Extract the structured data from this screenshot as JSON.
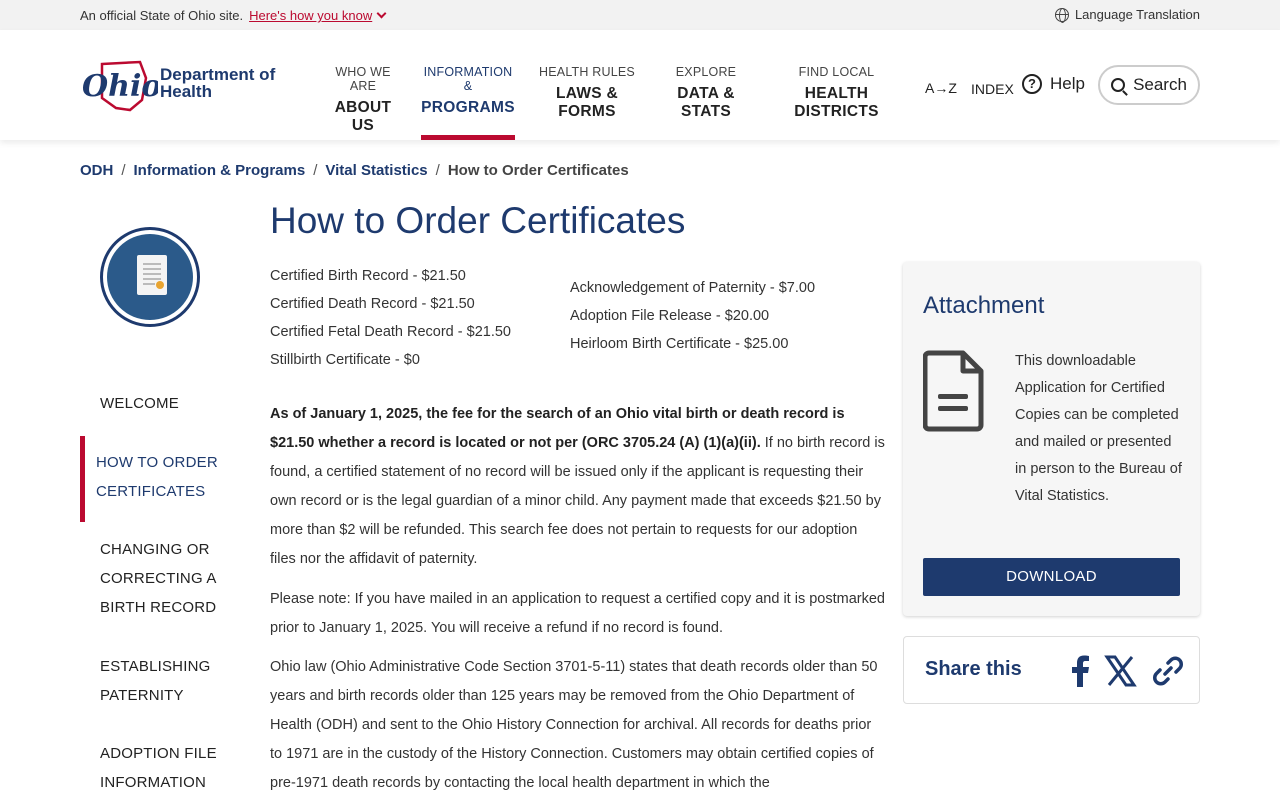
{
  "topbar": {
    "official": "An official State of Ohio site.",
    "how_know": "Here's how you know",
    "language": "Language Translation"
  },
  "header": {
    "logo_word": "Ohio",
    "dept_line1": "Department of",
    "dept_line2": "Health",
    "nav": [
      {
        "small": "WHO WE ARE",
        "big": "ABOUT US"
      },
      {
        "small": "INFORMATION &",
        "big": "PROGRAMS"
      },
      {
        "small": "HEALTH RULES",
        "big": "LAWS & FORMS"
      },
      {
        "small": "EXPLORE",
        "big": "DATA & STATS"
      },
      {
        "small": "FIND LOCAL",
        "big": "HEALTH DISTRICTS"
      }
    ],
    "az": "A→Z",
    "index": "INDEX",
    "help": "Help",
    "search": "Search"
  },
  "breadcrumb": {
    "items": [
      "ODH",
      "Information & Programs",
      "Vital Statistics"
    ],
    "current": "How to Order Certificates"
  },
  "sidebar": {
    "items": [
      "WELCOME",
      "HOW TO ORDER CERTIFICATES",
      "CHANGING OR CORRECTING A BIRTH RECORD",
      "ESTABLISHING PATERNITY",
      "ADOPTION FILE INFORMATION"
    ],
    "active_index": 1
  },
  "main": {
    "title": "How to Order Certificates",
    "fees_left": [
      "Certified Birth Record - $21.50",
      "Certified Death Record - $21.50",
      "Certified Fetal Death Record - $21.50",
      "Stillbirth Certificate - $0"
    ],
    "fees_right": [
      "Acknowledgement of Paternity - $7.00",
      "Adoption File Release - $20.00",
      "Heirloom Birth Certificate - $25.00"
    ],
    "p1_bold": "As of January 1, 2025, the fee for the search of an Ohio vital birth or death record is $21.50 whether a record is located or not per (ORC 3705.24 (A) (1)(a)(ii).",
    "p1_rest": " If no birth record is found, a certified statement of no record will be issued only if the applicant is requesting their own record or is the legal guardian of a minor child. Any payment made that exceeds $21.50 by more than $2 will be refunded. This search fee does not pertain to requests for our adoption files nor the affidavit of paternity.",
    "p2": "Please note: If you have mailed in an application to request a certified copy and it is postmarked prior to January 1, 2025. You will receive a refund if no record is found.",
    "p3": "Ohio law (Ohio Administrative Code Section 3701-5-11) states that death records older than 50 years and birth records older than 125 years may be removed from the Ohio Department of Health (ODH) and sent to the Ohio History Connection for archival. All records for deaths prior to 1971 are in the custody of the History Connection. Customers may obtain certified copies of pre-1971 death records by contacting the local health department in which the"
  },
  "attachment": {
    "heading": "Attachment",
    "description": "This downloadable Application for Certified Copies can be completed and mailed or presented in person to the Bureau of Vital Statistics.",
    "download": "DOWNLOAD"
  },
  "share": {
    "label": "Share this"
  },
  "colors": {
    "primary": "#1e3a6e",
    "accent": "#bb0a30"
  }
}
